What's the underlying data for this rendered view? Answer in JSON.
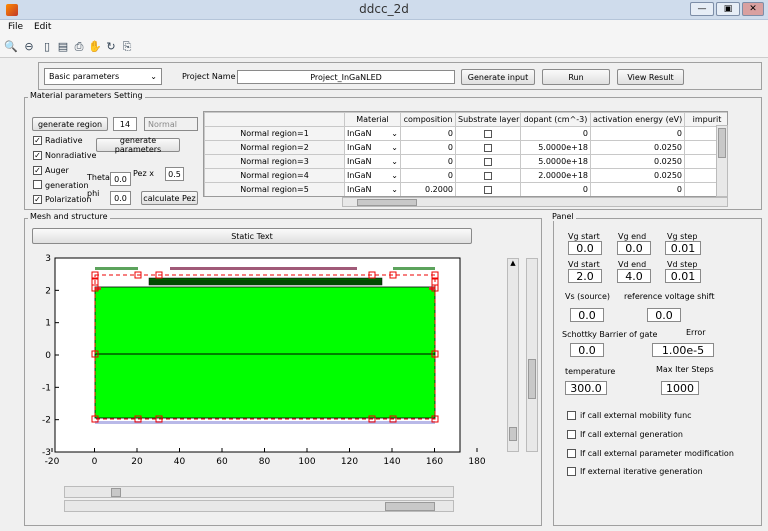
{
  "window": {
    "title": "ddcc_2d",
    "min": "—",
    "max": "▣",
    "close": "✕"
  },
  "menu": {
    "file": "File",
    "edit": "Edit"
  },
  "top": {
    "mode_select": "Basic parameters",
    "project_label": "Project Name",
    "project_value": "Project_InGaNLED",
    "generate_input": "Generate input",
    "run": "Run",
    "view_result": "View Result"
  },
  "material": {
    "section": "Material parameters Setting",
    "generate_region": "generate region",
    "region_count": "14",
    "region_type": "Normal",
    "checks": [
      {
        "label": "Radiative",
        "checked": true
      },
      {
        "label": "Nonradiative",
        "checked": true
      },
      {
        "label": "Auger",
        "checked": true
      },
      {
        "label": "generation",
        "checked": false
      },
      {
        "label": "Polarization",
        "checked": true
      }
    ],
    "generate_parameters": "generate parameters",
    "theta_label": "Theta",
    "theta_value": "0.0",
    "phi_label": "phi",
    "phi_value": "0.0",
    "pez_label": "Pez  x",
    "pez_value": "0.5",
    "calculate_pez": "calculate Pez",
    "columns": [
      "Material",
      "composition",
      "Substrate layer",
      "dopant (cm^-3)",
      "activation energy (eV)",
      "impurit"
    ],
    "rows": [
      {
        "name": "Normal region=1",
        "material": "InGaN",
        "composition": "0",
        "dopant": "0",
        "activation": "0"
      },
      {
        "name": "Normal region=2",
        "material": "InGaN",
        "composition": "0",
        "dopant": "5.0000e+18",
        "activation": "0.0250"
      },
      {
        "name": "Normal region=3",
        "material": "InGaN",
        "composition": "0",
        "dopant": "5.0000e+18",
        "activation": "0.0250"
      },
      {
        "name": "Normal region=4",
        "material": "InGaN",
        "composition": "0",
        "dopant": "2.0000e+18",
        "activation": "0.0250"
      },
      {
        "name": "Normal region=5",
        "material": "InGaN",
        "composition": "0.2000",
        "dopant": "0",
        "activation": "0"
      }
    ]
  },
  "mesh": {
    "section": "Mesh and structure",
    "static_text": "Static Text",
    "x_ticks": [
      "-20",
      "0",
      "20",
      "40",
      "60",
      "80",
      "100",
      "120",
      "140",
      "160",
      "180"
    ],
    "y_ticks": [
      "3",
      "2",
      "1",
      "0",
      "-1",
      "-2",
      "-3"
    ]
  },
  "panel": {
    "section": "Panel",
    "vg_start_label": "Vg start",
    "vg_start": "0.0",
    "vg_end_label": "Vg end",
    "vg_end": "0.0",
    "vg_step_label": "Vg step",
    "vg_step": "0.01",
    "vd_start_label": "Vd start",
    "vd_start": "2.0",
    "vd_end_label": "Vd end",
    "vd_end": "4.0",
    "vd_step_label": "Vd step",
    "vd_step": "0.01",
    "vs_label": "Vs (source)",
    "vs": "0.0",
    "ref_label": "reference voltage shift",
    "ref": "0.0",
    "schottky_label": "Schottky Barrier of gate",
    "schottky": "0.0",
    "error_label": "Error",
    "error": "1.00e-5",
    "temp_label": "temperature",
    "temp": "300.0",
    "iter_label": "Max Iter Steps",
    "iter": "1000",
    "options": [
      "if call external mobility func",
      "If call external generation",
      "If call external parameter modification",
      "If external iterative generation"
    ]
  }
}
